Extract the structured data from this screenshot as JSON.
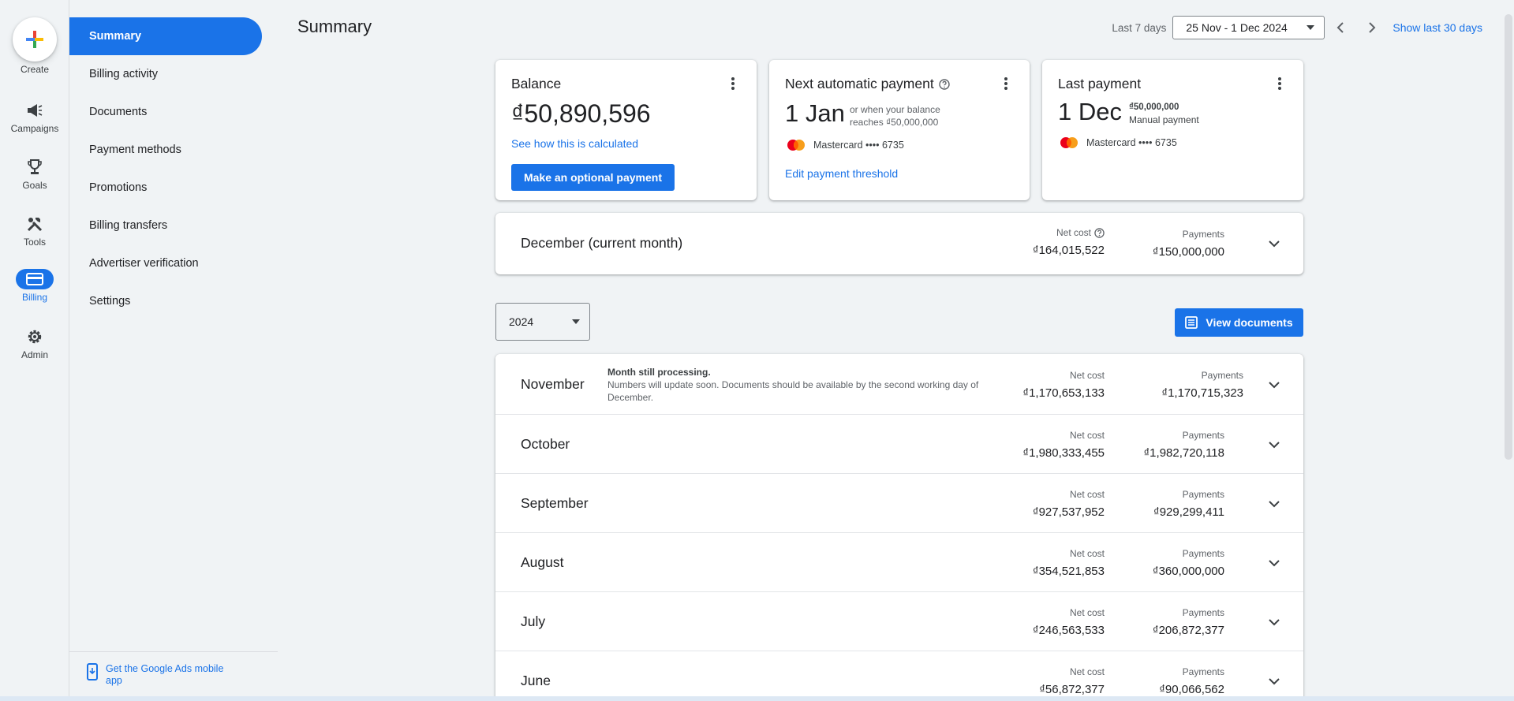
{
  "rail": {
    "create": "Create",
    "campaigns": "Campaigns",
    "goals": "Goals",
    "tools": "Tools",
    "billing": "Billing",
    "admin": "Admin"
  },
  "subnav": {
    "items": [
      "Summary",
      "Billing activity",
      "Documents",
      "Payment methods",
      "Promotions",
      "Billing transfers",
      "Advertiser verification",
      "Settings"
    ],
    "mobile_app": "Get the Google Ads mobile app"
  },
  "header": {
    "title": "Summary",
    "range_label": "Last 7 days",
    "date_range": "25 Nov - 1 Dec 2024",
    "show_30": "Show last 30 days"
  },
  "balance_card": {
    "title": "Balance",
    "amount": "₫50,890,596",
    "link": "See how this is calculated",
    "button": "Make an optional payment"
  },
  "next_payment_card": {
    "title": "Next automatic payment",
    "date": "1 Jan",
    "note_line1": "or when your balance",
    "note_line2": "reaches ₫50,000,000",
    "card": "Mastercard •••• 6735",
    "link": "Edit payment threshold"
  },
  "last_payment_card": {
    "title": "Last payment",
    "date": "1 Dec",
    "amount": "₫50,000,000",
    "type": "Manual payment",
    "card": "Mastercard •••• 6735"
  },
  "current_month": {
    "label": "December (current month)",
    "net_cost_label": "Net cost",
    "net_cost": "₫164,015,522",
    "payments_label": "Payments",
    "payments": "₫150,000,000"
  },
  "year_select": "2024",
  "view_documents": "View documents",
  "months": [
    {
      "name": "November",
      "net_cost": "₫1,170,653,133",
      "payments": "₫1,170,715,323",
      "note_title": "Month still processing.",
      "note": "Numbers will update soon. Documents should be available by the second working day of December."
    },
    {
      "name": "October",
      "net_cost": "₫1,980,333,455",
      "payments": "₫1,982,720,118"
    },
    {
      "name": "September",
      "net_cost": "₫927,537,952",
      "payments": "₫929,299,411"
    },
    {
      "name": "August",
      "net_cost": "₫354,521,853",
      "payments": "₫360,000,000"
    },
    {
      "name": "July",
      "net_cost": "₫246,563,533",
      "payments": "₫206,872,377"
    },
    {
      "name": "June",
      "net_cost": "₫56,872,377",
      "payments": "₫90,066,562"
    }
  ],
  "labels": {
    "net_cost": "Net cost",
    "payments": "Payments"
  },
  "colors": {
    "accent": "#1a73e8",
    "background": "#f0f3f5"
  }
}
